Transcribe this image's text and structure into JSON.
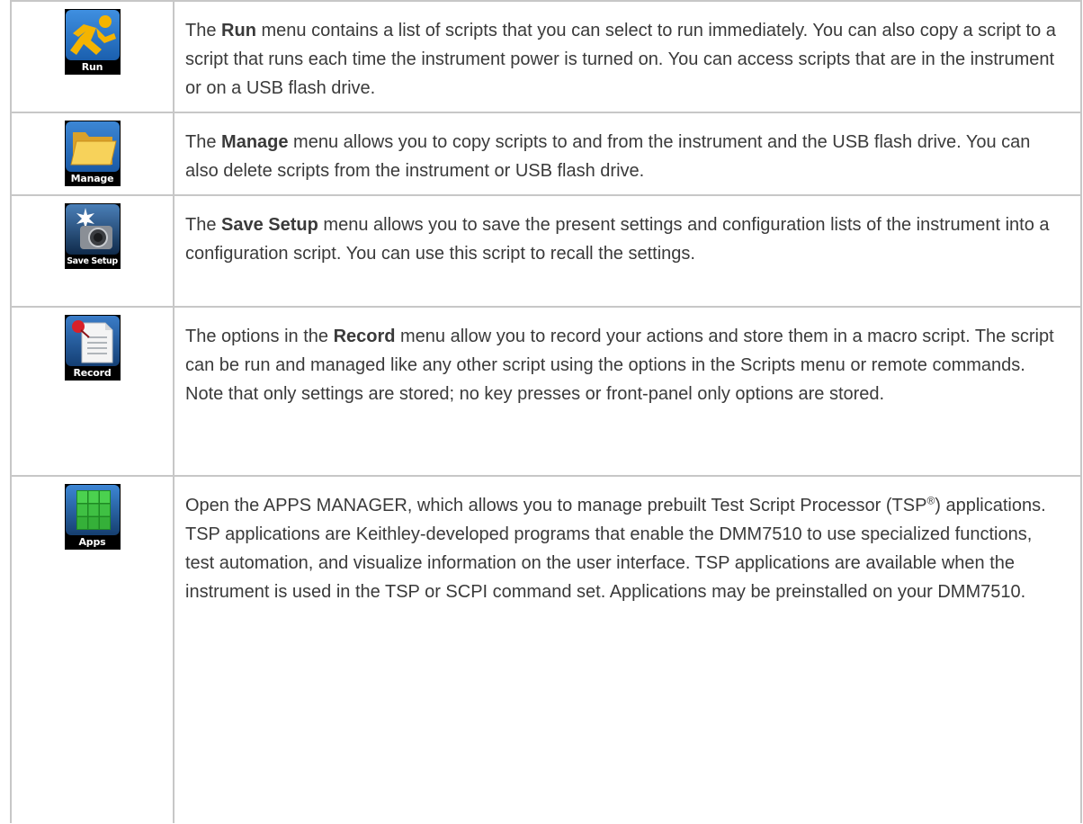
{
  "rows": [
    {
      "icon": "run-icon",
      "icon_label": "Run",
      "prefix": "The ",
      "bold": "Run",
      "text": " menu contains a list of scripts that you can select to run immediately. You can also copy a script to a script that runs each time the instrument power is turned on. You can access scripts that are in the instrument or on a USB flash drive."
    },
    {
      "icon": "folder-icon",
      "icon_label": "Manage",
      "prefix": "The ",
      "bold": "Manage",
      "text": " menu allows you to copy scripts to and from the instrument and the USB flash drive. You can also delete scripts from the instrument or USB flash drive."
    },
    {
      "icon": "camera-icon",
      "icon_label": "Save Setup",
      "prefix": "The ",
      "bold": "Save Setup",
      "text": " menu allows you to save the present settings and configuration lists of the instrument into a configuration script. You can use this script to recall the settings."
    },
    {
      "icon": "record-document-icon",
      "icon_label": "Record",
      "prefix": "The options in the ",
      "bold": "Record",
      "text": " menu allow you to record your actions and store them in a macro script. The script can be run and managed like any other script using the options in the Scripts menu or remote commands. Note that only settings are stored; no key presses or front-panel only options are stored."
    },
    {
      "icon": "apps-cube-icon",
      "icon_label": "Apps",
      "text_a": "Open the APPS MANAGER, which allows you to manage prebuilt Test Script Processor (TSP",
      "sup": "®",
      "text_b": ") applications. TSP applications are Keithley-developed programs that enable the DMM7510 to use specialized functions, test automation, and visualize information on the user interface. TSP applications are available when the instrument is used in the TSP or SCPI command set. Applications may be preinstalled on your DMM7510."
    }
  ],
  "colors": {
    "text": "#3a3a3a",
    "border": "#c7c7c7",
    "icon_background": "#000000",
    "run_tile": "#1f6fc0",
    "manage_tile": "#2a6fb8",
    "record_tile": "#1d5fa8",
    "apps_tile": "#1e6fc4"
  }
}
